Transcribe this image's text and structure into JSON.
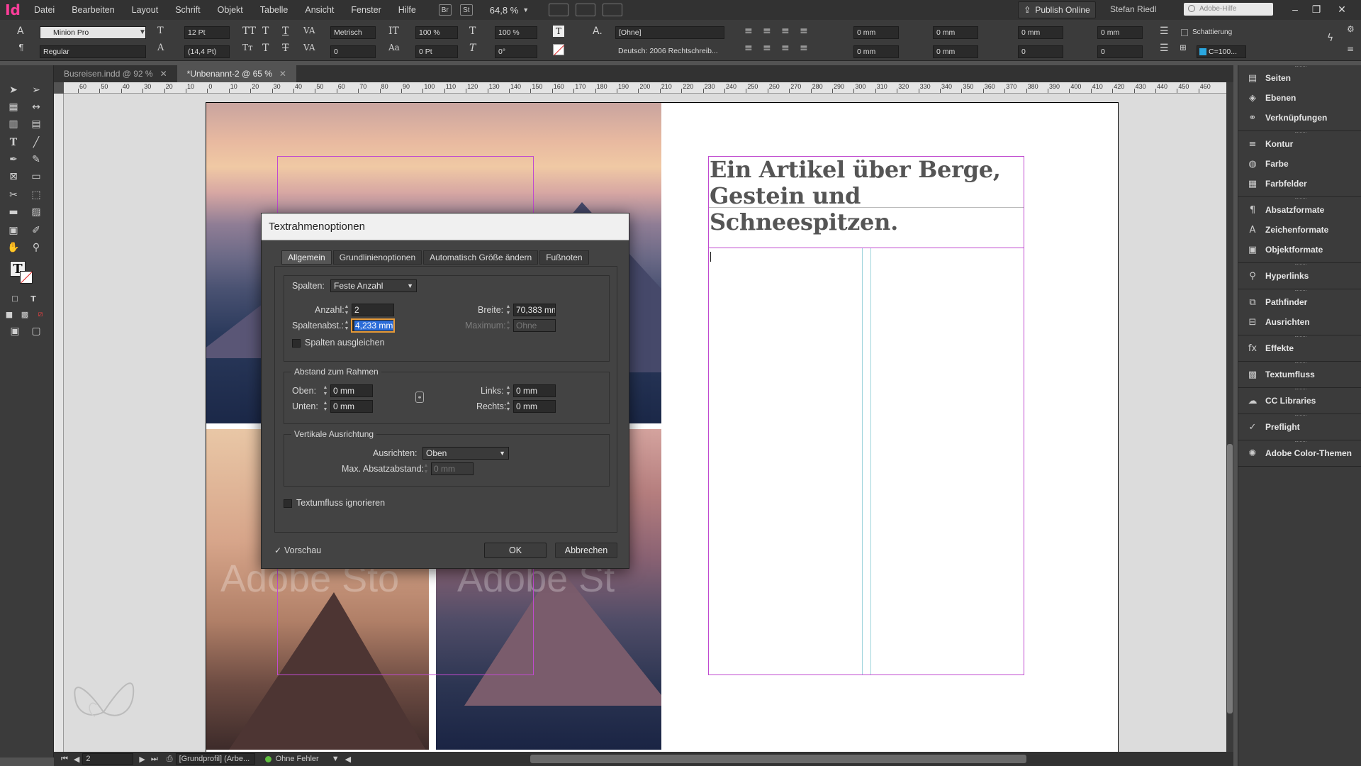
{
  "app": {
    "logo": "Id",
    "menu": [
      "Datei",
      "Bearbeiten",
      "Layout",
      "Schrift",
      "Objekt",
      "Tabelle",
      "Ansicht",
      "Fenster",
      "Hilfe"
    ],
    "bridge_label": "Br",
    "stock_label": "St",
    "zoom": "64,8 %",
    "publish_label": "Publish Online",
    "user": "Stefan Riedl",
    "help_placeholder": "Adobe-Hilfe"
  },
  "control": {
    "font_family": "Minion Pro",
    "font_style": "Regular",
    "font_size": "12 Pt",
    "leading": "(14,4 Pt)",
    "kerning": "Metrisch",
    "tracking": "0",
    "vscale": "100 %",
    "hscale": "100 %",
    "baseline": "0 Pt",
    "skew": "0°",
    "char_style": "[Ohne]",
    "language": "Deutsch: 2006 Rechtschreib...",
    "indent_left": "0 mm",
    "indent_first": "0 mm",
    "indent_right": "0 mm",
    "indent_last": "0 mm",
    "space_before": "0 mm",
    "space_after": "0 mm",
    "dropcap_lines": "0",
    "dropcap_chars": "0",
    "shading_label": "Schattierung",
    "swatch_label": "C=100..."
  },
  "tabs": [
    {
      "label": "Busreisen.indd @ 92 %",
      "active": false
    },
    {
      "label": "*Unbenannt-2 @ 65 %",
      "active": true
    }
  ],
  "ruler_top": [
    "60",
    "50",
    "40",
    "30",
    "20",
    "10",
    "0",
    "10",
    "20",
    "30",
    "40",
    "50",
    "60",
    "70",
    "80",
    "90",
    "100",
    "110",
    "120",
    "130",
    "140",
    "150",
    "160",
    "170",
    "180",
    "190",
    "200",
    "210",
    "220",
    "230",
    "240",
    "250",
    "260",
    "270",
    "280",
    "290",
    "300",
    "310",
    "320",
    "330",
    "340",
    "350",
    "360",
    "370",
    "380",
    "390",
    "400",
    "410",
    "420",
    "430",
    "440",
    "450",
    "460"
  ],
  "document": {
    "headline": "Ein Artikel über Berge, Gestein und Schneespitzen.",
    "watermark": "Adobe Sto",
    "watermark2": "Adobe St"
  },
  "dialog": {
    "title": "Textrahmenoptionen",
    "tabs": [
      "Allgemein",
      "Grundlinienoptionen",
      "Automatisch Größe ändern",
      "Fußnoten"
    ],
    "columns_label": "Spalten:",
    "columns_mode": "Feste Anzahl",
    "count_label": "Anzahl:",
    "count_value": "2",
    "width_label": "Breite:",
    "width_value": "70,383 mm",
    "gutter_label": "Spaltenabst.:",
    "gutter_value": "4,233 mm",
    "max_label": "Maximum:",
    "max_value": "Ohne",
    "balance_label": "Spalten ausgleichen",
    "inset_title": "Abstand zum Rahmen",
    "top_label": "Oben:",
    "top_value": "0 mm",
    "bottom_label": "Unten:",
    "bottom_value": "0 mm",
    "left_label": "Links:",
    "left_value": "0 mm",
    "right_label": "Rechts:",
    "right_value": "0 mm",
    "vjust_title": "Vertikale Ausrichtung",
    "align_label": "Ausrichten:",
    "align_value": "Oben",
    "max_para_label": "Max. Absatzabstand:",
    "max_para_value": "0 mm",
    "ignore_wrap_label": "Textumfluss ignorieren",
    "preview_label": "Vorschau",
    "ok_label": "OK",
    "cancel_label": "Abbrechen"
  },
  "panels": [
    {
      "group": [
        {
          "icon": "pages-icon",
          "glyph": "▤",
          "label": "Seiten"
        },
        {
          "icon": "layers-icon",
          "glyph": "◈",
          "label": "Ebenen"
        },
        {
          "icon": "links-icon",
          "glyph": "⚭",
          "label": "Verknüpfungen"
        }
      ]
    },
    {
      "group": [
        {
          "icon": "stroke-icon",
          "glyph": "≡",
          "label": "Kontur"
        },
        {
          "icon": "color-icon",
          "glyph": "◍",
          "label": "Farbe"
        },
        {
          "icon": "swatches-icon",
          "glyph": "▦",
          "label": "Farbfelder"
        }
      ]
    },
    {
      "group": [
        {
          "icon": "paragraph-styles-icon",
          "glyph": "¶",
          "label": "Absatzformate"
        },
        {
          "icon": "character-styles-icon",
          "glyph": "A",
          "label": "Zeichenformate"
        },
        {
          "icon": "object-styles-icon",
          "glyph": "▣",
          "label": "Objektformate"
        }
      ]
    },
    {
      "group": [
        {
          "icon": "hyperlinks-icon",
          "glyph": "⚲",
          "label": "Hyperlinks"
        }
      ]
    },
    {
      "group": [
        {
          "icon": "pathfinder-icon",
          "glyph": "⧉",
          "label": "Pathfinder"
        },
        {
          "icon": "align-icon",
          "glyph": "⊟",
          "label": "Ausrichten"
        }
      ]
    },
    {
      "group": [
        {
          "icon": "effects-icon",
          "glyph": "fx",
          "label": "Effekte"
        }
      ]
    },
    {
      "group": [
        {
          "icon": "text-wrap-icon",
          "glyph": "▩",
          "label": "Textumfluss"
        }
      ]
    },
    {
      "group": [
        {
          "icon": "cc-libraries-icon",
          "glyph": "☁",
          "label": "CC Libraries"
        }
      ]
    },
    {
      "group": [
        {
          "icon": "preflight-icon",
          "glyph": "✓",
          "label": "Preflight"
        }
      ]
    },
    {
      "group": [
        {
          "icon": "color-themes-icon",
          "glyph": "✺",
          "label": "Adobe Color-Themen"
        }
      ]
    }
  ],
  "status": {
    "page": "2",
    "profile": "[Grundprofil] (Arbe...",
    "errors": "Ohne Fehler"
  },
  "colors": {
    "frame": "#c04ad0",
    "accent_logo": "#ff3d9a",
    "ok_green": "#5fbf3f"
  }
}
